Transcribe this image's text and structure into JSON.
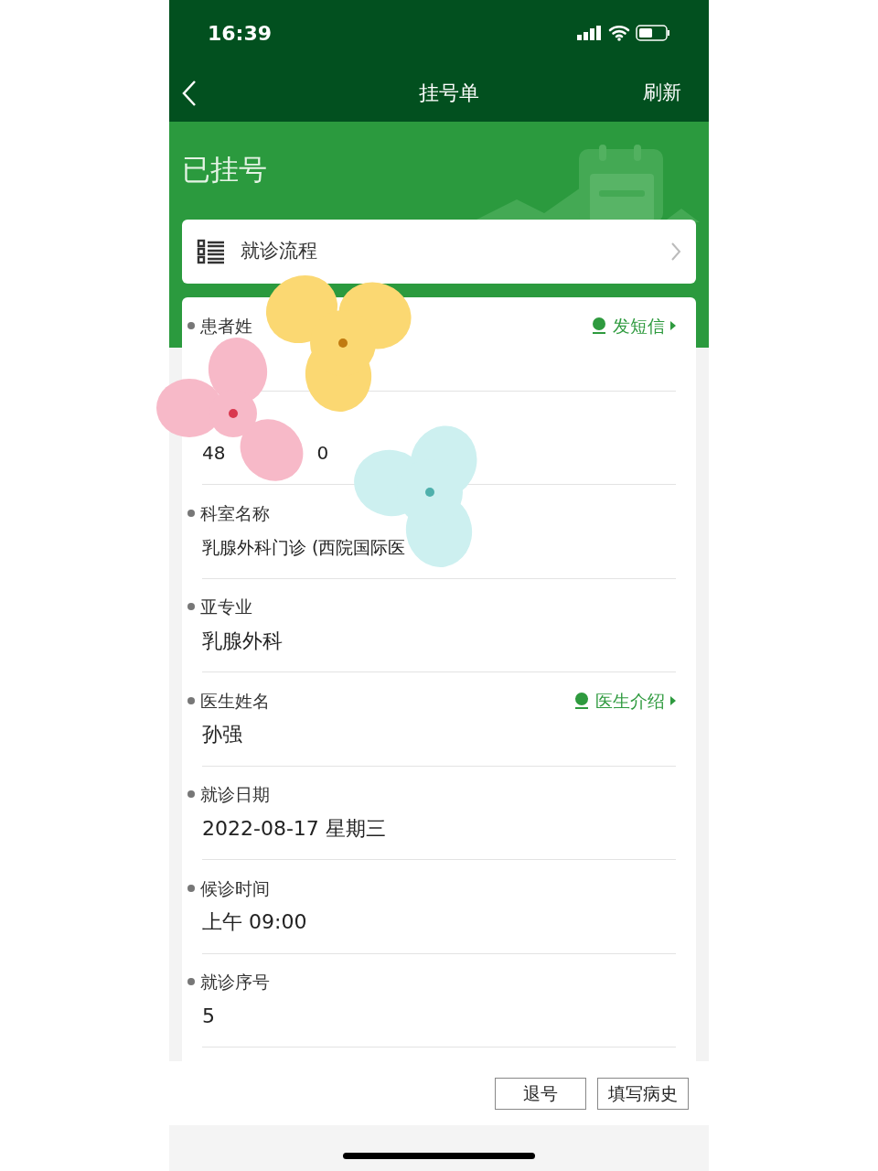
{
  "status_bar": {
    "time": "16:39"
  },
  "nav": {
    "title": "挂号单",
    "action": "刷新"
  },
  "status_title": "已挂号",
  "process_link": {
    "label": "就诊流程"
  },
  "fields": [
    {
      "label": "患者姓",
      "action": "发短信"
    },
    {
      "value_parts": [
        "48",
        "0"
      ]
    },
    {
      "label": "科室名称",
      "value": "乳腺外科门诊 (西院国际医"
    },
    {
      "label": "亚专业",
      "value": "乳腺外科"
    },
    {
      "label": "医生姓名",
      "value": "孙强",
      "action": "医生介绍"
    },
    {
      "label": "就诊日期",
      "value": "2022-08-17 星期三"
    },
    {
      "label": "候诊时间",
      "value": "上午 09:00"
    },
    {
      "label": "就诊序号",
      "value": "5"
    }
  ],
  "buttons": [
    {
      "label": "退号"
    },
    {
      "label": "填写病史"
    }
  ]
}
